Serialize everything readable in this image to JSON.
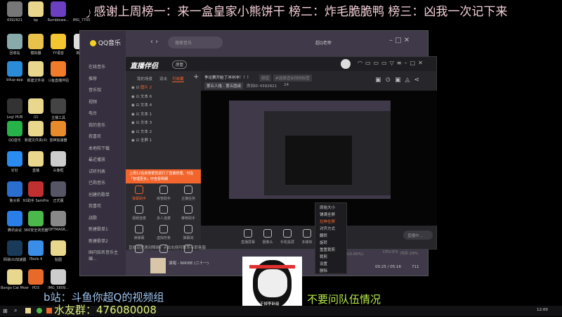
{
  "banner": {
    "text": "🎙感谢上周榜一：来一盒皇家小熊饼干 榜二：炸毛脆脆鸭 榜三：凶我一次记下来"
  },
  "desktop_icons": [
    {
      "label": "4392821",
      "color": "#777"
    },
    {
      "label": "bp",
      "color": "#e8d78c"
    },
    {
      "label": "Rumblewe...",
      "color": "#6a3fc0"
    },
    {
      "label": "IMG_7705",
      "color": "#000"
    },
    {
      "label": "回收站",
      "color": "#8aa"
    },
    {
      "label": "模拟器",
      "color": "#e8c24a"
    },
    {
      "label": "YY语音",
      "color": "#f3c530"
    },
    {
      "label": "新建文",
      "color": "#ddd"
    },
    {
      "label": "bilup-app",
      "color": "#2a8bd8"
    },
    {
      "label": "新建文件夹",
      "color": "#e8d78c"
    },
    {
      "label": "斗鱼直播伴侣",
      "color": "#f07b2a"
    },
    {
      "label": "Logi HUB",
      "color": "#333"
    },
    {
      "label": "(2)",
      "color": "#e8d78c"
    },
    {
      "label": "主播工具",
      "color": "#444"
    },
    {
      "label": "QQ音乐",
      "color": "#27b24a"
    },
    {
      "label": "新建文件夹(4)",
      "color": "#e8d78c"
    },
    {
      "label": "雷神加速器",
      "color": "#e88b2a"
    },
    {
      "label": "钉钉",
      "color": "#2a8bf0"
    },
    {
      "label": "直播",
      "color": "#e8d78c"
    },
    {
      "label": "头像框",
      "color": "#ccc"
    },
    {
      "label": "鲁大师",
      "color": "#2a6fd0"
    },
    {
      "label": "91助手 SamPro",
      "color": "#c03030"
    },
    {
      "label": "正式服",
      "color": "#556"
    },
    {
      "label": "腾讯会议",
      "color": "#2a7ee8"
    },
    {
      "label": "360安全浏览器",
      "color": "#4cb84c"
    },
    {
      "label": "OPTMASR...",
      "color": "#888"
    },
    {
      "label": "网易UU加速器",
      "color": "#1a3a5a"
    },
    {
      "label": "iTools 4",
      "color": "#3a8ee8"
    },
    {
      "label": "贴图",
      "color": "#e8d78c"
    },
    {
      "label": "Bongo Cat Mver",
      "color": "#e8d78c"
    },
    {
      "label": "PD3",
      "color": "#e86a2a"
    },
    {
      "label": "IMG_5809...",
      "color": "#ccc"
    }
  ],
  "qq_music": {
    "logo": "QQ音乐",
    "search_placeholder": "搜索音乐",
    "user": "超Q老师",
    "nav": [
      "在线音乐",
      "推荐",
      "音乐馆",
      "视频",
      "电台",
      "我的音乐",
      "我喜欢",
      "本地和下载",
      "最近播放",
      "试听列表",
      "已购音乐",
      "创建的歌单",
      "我喜欢",
      "战歌",
      "新建歌单1",
      "新建歌单2",
      "国内知名音乐主编..."
    ],
    "now_playing": "演唱 - NIKI8E (二十一)",
    "time": "00:25 / 05:16",
    "count": "711"
  },
  "live": {
    "logo": "直播伴侣",
    "badge": "房管",
    "title": "争论赛开始了冲冲冲！！！",
    "tag1": "频道",
    "tag2": "#选择适合你的标签",
    "category": "第五人格 · 第五圆桌",
    "room": "房间ID 4392821",
    "fans": "24",
    "tabs": [
      "我的场景",
      "双击",
      "可收藏"
    ],
    "layers": [
      "图片 2",
      "文本 6",
      "文本 4",
      "文本 1",
      "文本 3",
      "文本 2",
      "全屏 1"
    ],
    "notice": "上周12名房管帮您进行了直播管理，可在「管理更多」中查看明细",
    "tools": [
      "弹幕助手",
      "房管助手",
      "主播任务",
      "视频连麦",
      "多人连麦",
      "推荐助手",
      "读弹幕",
      "虚拟形象",
      "弹幕询",
      "",
      "",
      ""
    ],
    "bottom_notice": "直播设置遇到障碍？点击右侧可联系专职客服",
    "toolbar": [
      "直播屏幕",
      "摄像头",
      "手机投屏",
      "多媒体"
    ],
    "live_button": "直播中...",
    "stats": {
      "dropped": "丢帧:0(0.00%)",
      "cpu": "CPU:5%",
      "mem": "内存:29%"
    },
    "context_menu": [
      "原始大小",
      "铺满全屏",
      "拉伸全屏",
      "对齐方式",
      "翻转",
      "旋转",
      "重置裁剪",
      "裁剪",
      "设置",
      "删除"
    ]
  },
  "meme": {
    "caption": "干掉李卧级"
  },
  "overlay": {
    "bilibili": "b站：斗鱼你超Q的视频组",
    "group": "水友群：476080008",
    "team": "不要问队伍情况"
  },
  "taskbar": {
    "clock": "12:00"
  }
}
